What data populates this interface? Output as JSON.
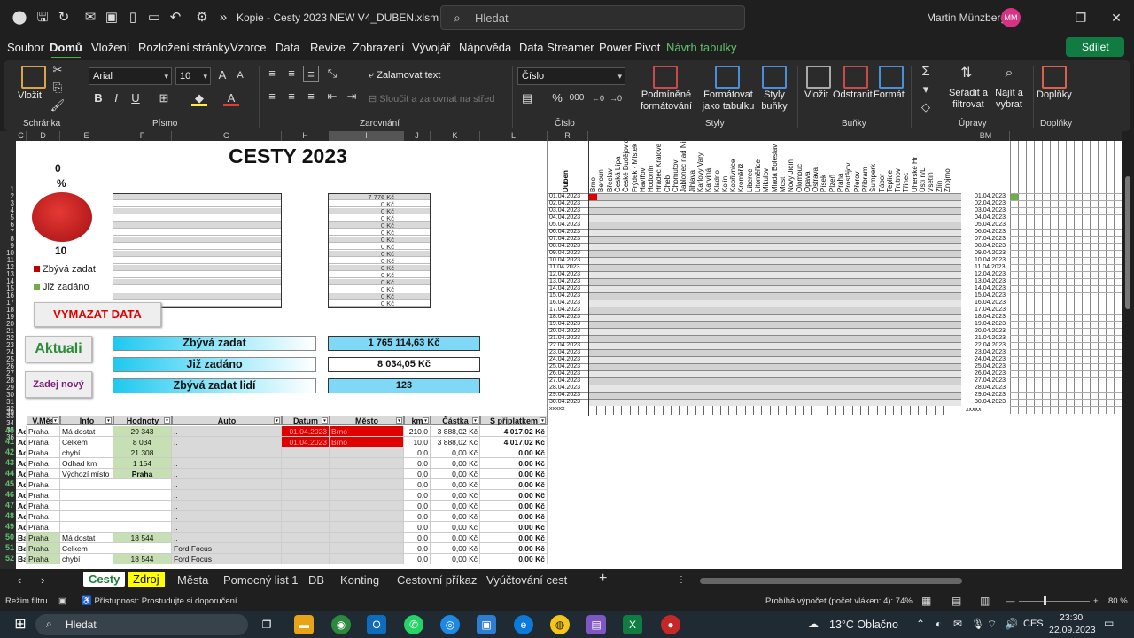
{
  "titlebar": {
    "doc_title": "Kopie - Cesty 2023 NEW V4_DUBEN.xlsm  -  E...",
    "search_placeholder": "Hledat",
    "user": "Martin Münzberg",
    "initials": "MM"
  },
  "menu": [
    "Soubor",
    "Domů",
    "Vložení",
    "Rozložení stránky",
    "Vzorce",
    "Data",
    "Revize",
    "Zobrazení",
    "Vývojář",
    "Nápověda",
    "Data Streamer",
    "Power Pivot",
    "Návrh tabulky"
  ],
  "share_label": "Sdílet",
  "ribbon": {
    "paste": "Vložit",
    "clipboard": "Schránka",
    "font_name": "Arial",
    "font_size": "10",
    "font_group": "Písmo",
    "wrap_text": "Zalamovat text",
    "merge_center": "Sloučit a zarovnat na střed",
    "alignment_group": "Zarovnání",
    "number_format": "Číslo",
    "number_group": "Číslo",
    "conditional": "Podmíněné formátování",
    "format_table": "Formátovat jako tabulku",
    "cell_styles": "Styly buňky",
    "styles_group": "Styly",
    "insert": "Vložit",
    "delete": "Odstranit",
    "format": "Formát",
    "cells_group": "Buňky",
    "sort_filter": "Seřadit a filtrovat",
    "find_select": "Najít a vybrat",
    "editing_group": "Úpravy",
    "addins": "Doplňky",
    "addins_group": "Doplňky"
  },
  "sheet": {
    "title": "CESTY 2023",
    "pie_top": "0",
    "pie_pct": "%",
    "pie_bottom": "10",
    "legend_remaining": "Zbývá zadat",
    "legend_entered": "Již zadáno",
    "mini_table_values": [
      "7 776 Kč",
      "0 Kč",
      "0 Kč",
      "0 Kč",
      "0 Kč",
      "0 Kč",
      "0 Kč",
      "0 Kč",
      "0 Kč",
      "0 Kč",
      "0 Kč",
      "0 Kč",
      "0 Kč",
      "0 Kč",
      "0 Kč",
      "0 Kč"
    ],
    "btn_clear": "VYMAZAT DATA",
    "btn_refresh": "Aktuali",
    "btn_new": "Zadej nový",
    "sum_rows": [
      {
        "label": "Zbývá zadat",
        "value": "1 765 114,63 Kč"
      },
      {
        "label": "Již zadáno",
        "value": "8 034,05 Kč"
      },
      {
        "label": "Zbývá zadat lidí",
        "value": "123"
      }
    ],
    "table_headers": [
      "V.Měs",
      "Info",
      "Hodnoty",
      "Auto",
      "Datum",
      "Město",
      "km",
      "Částka",
      "S připlatkem"
    ],
    "table_rows": [
      {
        "r": "40",
        "a": "Ad",
        "vm": "Praha",
        "info": "Má dostat",
        "hod": "29 343",
        "auto": "..",
        "datum": "01.04.2023",
        "mesto": "Brno",
        "km": "210,0",
        "castka": "3 888,02 Kč",
        "spr": "4 017,02 Kč"
      },
      {
        "r": "41",
        "a": "Ad",
        "vm": "Praha",
        "info": "Celkem",
        "hod": "8 034",
        "auto": "..",
        "datum": "01.04.2023",
        "mesto": "Brno",
        "km": "10,0",
        "castka": "3 888,02 Kč",
        "spr": "4 017,02 Kč"
      },
      {
        "r": "42",
        "a": "Ad",
        "vm": "Praha",
        "info": "chybí",
        "hod": "21 308",
        "auto": "..",
        "datum": "",
        "mesto": "",
        "km": "0,0",
        "castka": "0,00 Kč",
        "spr": "0,00 Kč"
      },
      {
        "r": "43",
        "a": "Ad",
        "vm": "Praha",
        "info": "Odhad km",
        "hod": "1 154",
        "auto": "..",
        "datum": "",
        "mesto": "",
        "km": "0,0",
        "castka": "0,00 Kč",
        "spr": "0,00 Kč"
      },
      {
        "r": "44",
        "a": "Ad",
        "vm": "Praha",
        "info": "Výchozí místo",
        "hod": "Praha",
        "auto": "..",
        "datum": "",
        "mesto": "",
        "km": "0,0",
        "castka": "0,00 Kč",
        "spr": "0,00 Kč"
      },
      {
        "r": "45",
        "a": "Ad",
        "vm": "Praha",
        "info": "",
        "hod": "",
        "auto": "..",
        "datum": "",
        "mesto": "",
        "km": "0,0",
        "castka": "0,00 Kč",
        "spr": "0,00 Kč"
      },
      {
        "r": "46",
        "a": "Ad",
        "vm": "Praha",
        "info": "",
        "hod": "",
        "auto": "..",
        "datum": "",
        "mesto": "",
        "km": "0,0",
        "castka": "0,00 Kč",
        "spr": "0,00 Kč"
      },
      {
        "r": "47",
        "a": "Ad",
        "vm": "Praha",
        "info": "",
        "hod": "",
        "auto": "..",
        "datum": "",
        "mesto": "",
        "km": "0,0",
        "castka": "0,00 Kč",
        "spr": "0,00 Kč"
      },
      {
        "r": "48",
        "a": "Ad",
        "vm": "Praha",
        "info": "",
        "hod": "",
        "auto": "..",
        "datum": "",
        "mesto": "",
        "km": "0,0",
        "castka": "0,00 Kč",
        "spr": "0,00 Kč"
      },
      {
        "r": "49",
        "a": "Ad",
        "vm": "Praha",
        "info": "",
        "hod": "",
        "auto": "..",
        "datum": "",
        "mesto": "",
        "km": "0,0",
        "castka": "0,00 Kč",
        "spr": "0,00 Kč"
      },
      {
        "r": "50",
        "a": "Ba",
        "vm": "Praha",
        "info": "Má dostat",
        "hod": "18 544",
        "auto": "..",
        "datum": "",
        "mesto": "",
        "km": "0,0",
        "castka": "0,00 Kč",
        "spr": "0,00 Kč"
      },
      {
        "r": "51",
        "a": "Ba",
        "vm": "Praha",
        "info": "Celkem",
        "hod": "-",
        "auto": "Ford Focus",
        "datum": "",
        "mesto": "",
        "km": "0,0",
        "castka": "0,00 Kč",
        "spr": "0,00 Kč"
      },
      {
        "r": "52",
        "a": "Ba",
        "vm": "Praha",
        "info": "chybí",
        "hod": "18 544",
        "auto": "Ford Focus",
        "datum": "",
        "mesto": "",
        "km": "0,0",
        "castka": "0,00 Kč",
        "spr": "0,00 Kč"
      }
    ],
    "grid_head_r": "Duben",
    "grid_head_bm": "BM",
    "cities": [
      "Brno",
      "Beroun",
      "Břeclav",
      "Česká Lípa",
      "České Budějovice",
      "Frýdek - Místek",
      "Havířov",
      "Hodonín",
      "Hradec Králové",
      "Cheb",
      "Chomutov",
      "Jablonec nad Nisou",
      "Jihlava",
      "Karlovy Vary",
      "Karviná",
      "Kladno",
      "Kolín",
      "Kopřivnice",
      "Kroměříž",
      "Liberec",
      "Litoměřice",
      "Mikulov",
      "Mladá Boleslav",
      "Most",
      "Nový Jičín",
      "Olomouc",
      "Opava",
      "Ostrava",
      "Písek",
      "Plzeň",
      "Praha",
      "Prostějov",
      "Přerov",
      "Příbram",
      "Šumperk",
      "Tábor",
      "Teplice",
      "Trutnov",
      "Třinec",
      "Uherské Hr",
      "Ústí n/L",
      "Vsetín",
      "Zlín",
      "Znojmo"
    ],
    "dates": [
      "01.04.2023",
      "02.04.2023",
      "03.04.2023",
      "04.04.2023",
      "05.04.2023",
      "06.04.2023",
      "07.04.2023",
      "08.04.2023",
      "09.04.2023",
      "10.04.2023",
      "11.04.2023",
      "12.04.2023",
      "13.04.2023",
      "14.04.2023",
      "15.04.2023",
      "16.04.2023",
      "17.04.2023",
      "18.04.2023",
      "19.04.2023",
      "20.04.2023",
      "21.04.2023",
      "22.04.2023",
      "23.04.2023",
      "24.04.2023",
      "25.04.2023",
      "26.04.2023",
      "27.04.2023",
      "28.04.2023",
      "29.04.2023",
      "30.04.2023"
    ],
    "dates_tail": "xxxxx",
    "row_numbers": [
      "1",
      "2",
      "3",
      "4",
      "5",
      "6",
      "7",
      "8",
      "9",
      "10",
      "11",
      "12",
      "13",
      "14",
      "15",
      "16",
      "17",
      "18",
      "19",
      "20",
      "21",
      "22",
      "23",
      "24",
      "25",
      "26",
      "27",
      "28",
      "29",
      "30",
      "31",
      "32",
      "33",
      "34",
      "35",
      "36",
      "39"
    ],
    "col_letters": [
      "C",
      "D",
      "E",
      "F",
      "G",
      "H",
      "I",
      "J",
      "K",
      "L",
      "R",
      "BM"
    ]
  },
  "sheet_tabs": [
    "Cesty",
    "Zdroj",
    "Města",
    "Pomocný list 1",
    "DB",
    "Konting",
    "Cestovní příkaz",
    "Vyúčtování cest"
  ],
  "status": {
    "mode": "Režim filtru",
    "accessibility": "Přístupnost: Prostudujte si doporučení",
    "calc": "Probíhá výpočet (počet vláken: 4): 74%",
    "zoom": "80 %"
  },
  "taskbar": {
    "search": "Hledat",
    "weather": "13°C  Oblačno",
    "lang": "CES",
    "time": "23:30",
    "date": "22.09.2023"
  },
  "colors": {
    "accent_green": "#107c41",
    "red_fill": "#e00000",
    "green_fill": "#c6e0b4"
  }
}
